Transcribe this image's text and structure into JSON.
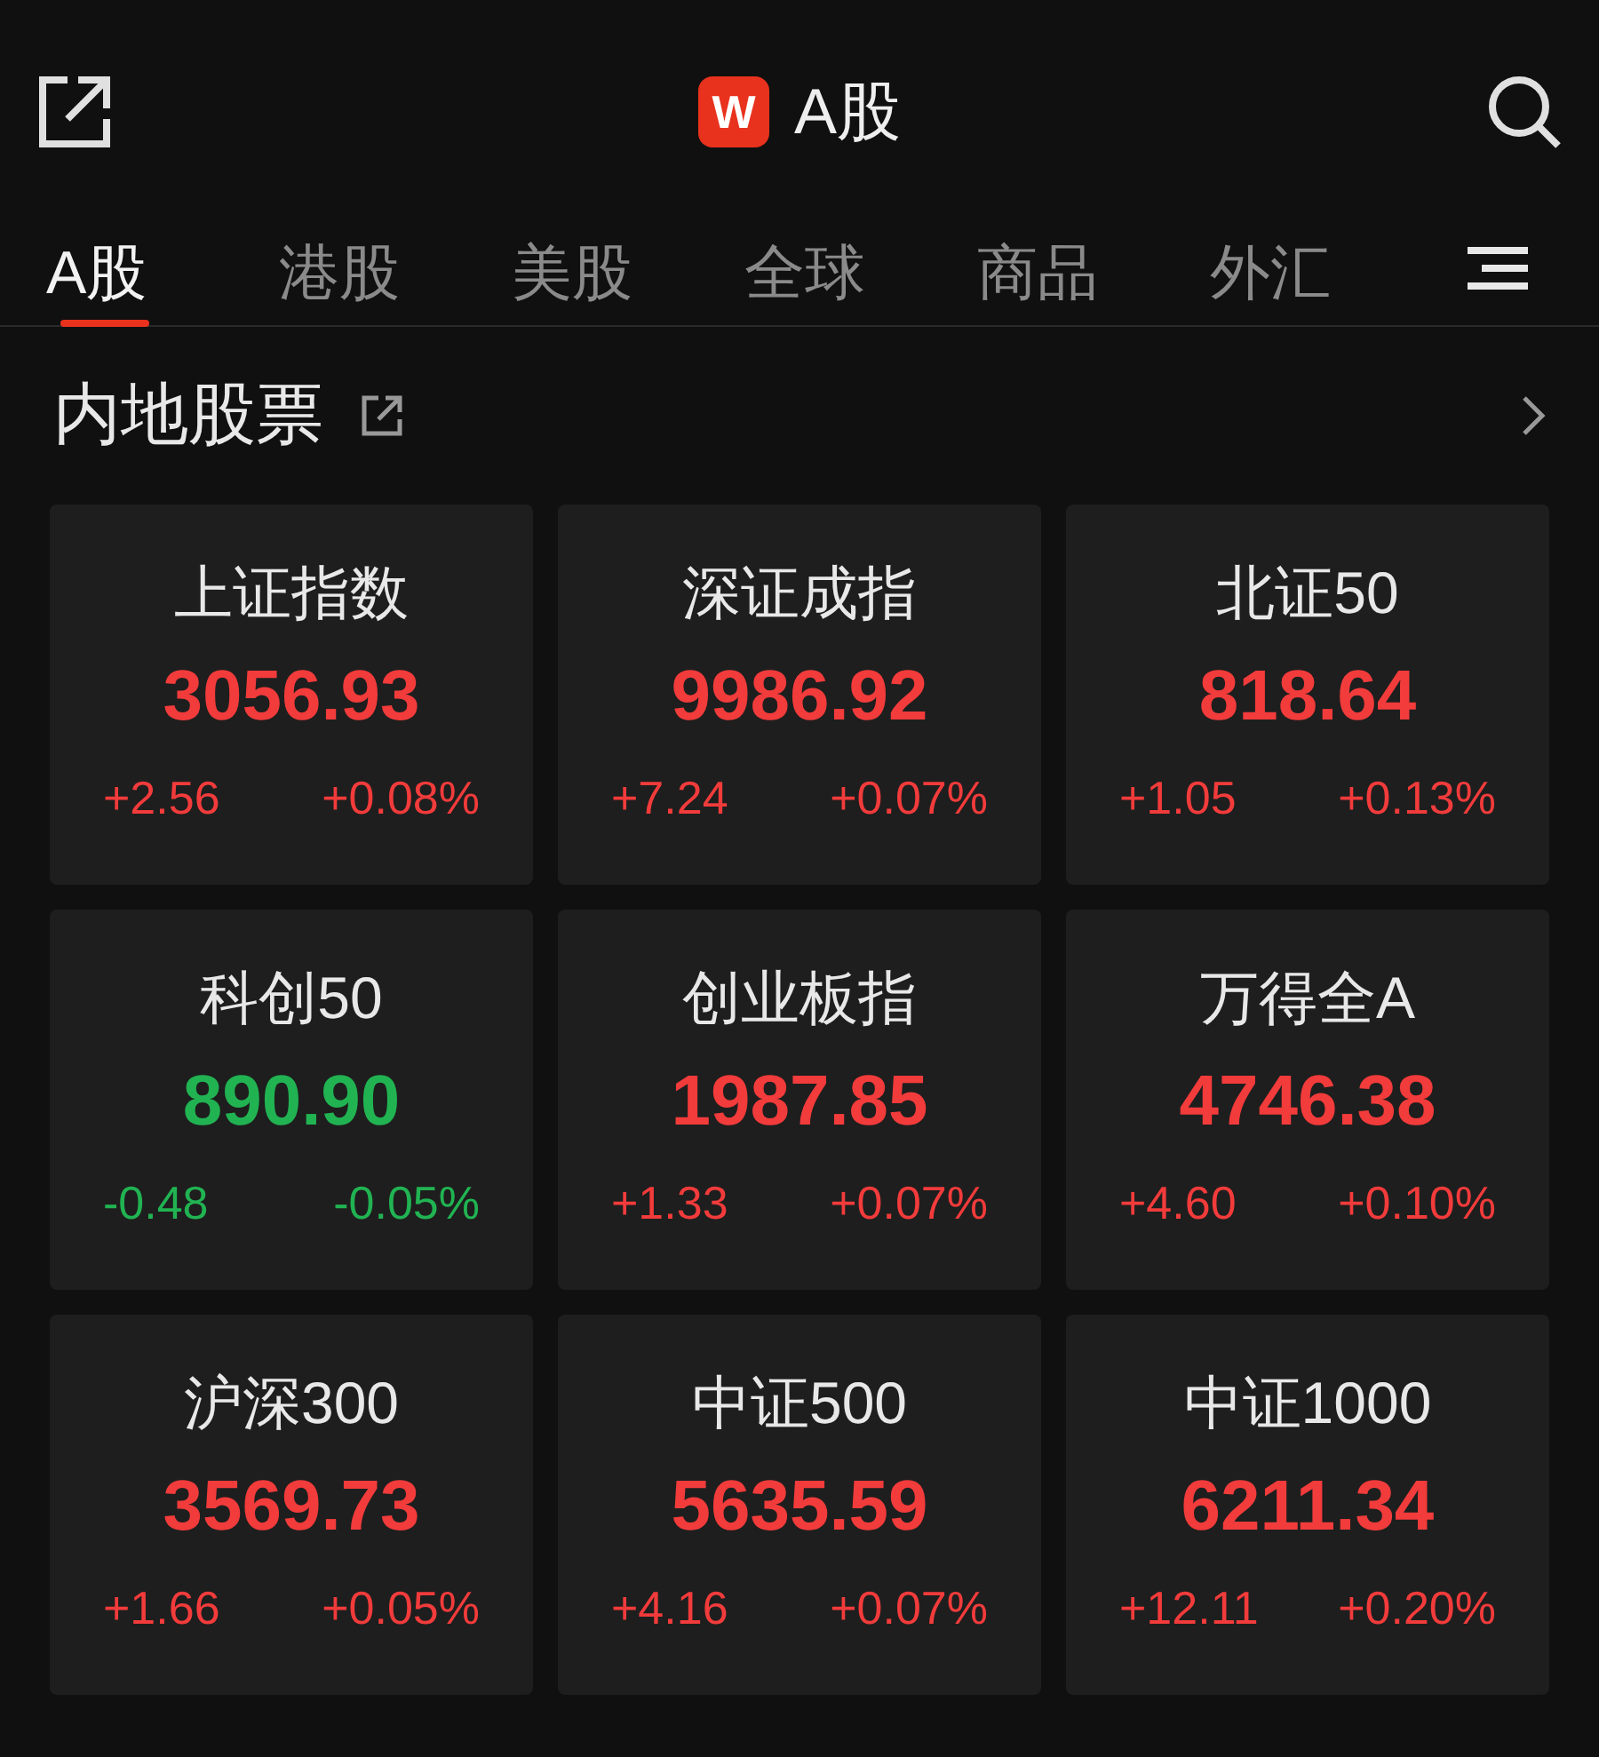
{
  "header": {
    "logo": "W",
    "title": "A股"
  },
  "tabs": [
    {
      "label": "A股",
      "selected": true
    },
    {
      "label": "港股",
      "selected": false
    },
    {
      "label": "美股",
      "selected": false
    },
    {
      "label": "全球",
      "selected": false
    },
    {
      "label": "商品",
      "selected": false
    },
    {
      "label": "外汇",
      "selected": false
    }
  ],
  "section": {
    "title": "内地股票"
  },
  "indices": [
    {
      "name": "上证指数",
      "value": "3056.93",
      "change": "+2.56",
      "percent": "+0.08%",
      "color": "#f23b3b"
    },
    {
      "name": "深证成指",
      "value": "9986.92",
      "change": "+7.24",
      "percent": "+0.07%",
      "color": "#f23b3b"
    },
    {
      "name": "北证50",
      "value": "818.64",
      "change": "+1.05",
      "percent": "+0.13%",
      "color": "#f23b3b"
    },
    {
      "name": "科创50",
      "value": "890.90",
      "change": "-0.48",
      "percent": "-0.05%",
      "color": "#21b352"
    },
    {
      "name": "创业板指",
      "value": "1987.85",
      "change": "+1.33",
      "percent": "+0.07%",
      "color": "#f23b3b"
    },
    {
      "name": "万得全A",
      "value": "4746.38",
      "change": "+4.60",
      "percent": "+0.10%",
      "color": "#f23b3b"
    },
    {
      "name": "沪深300",
      "value": "3569.73",
      "change": "+1.66",
      "percent": "+0.05%",
      "color": "#f23b3b"
    },
    {
      "name": "中证500",
      "value": "5635.59",
      "change": "+4.16",
      "percent": "+0.07%",
      "color": "#f23b3b"
    },
    {
      "name": "中证1000",
      "value": "6211.34",
      "change": "+12.11",
      "percent": "+0.20%",
      "color": "#f23b3b"
    }
  ]
}
